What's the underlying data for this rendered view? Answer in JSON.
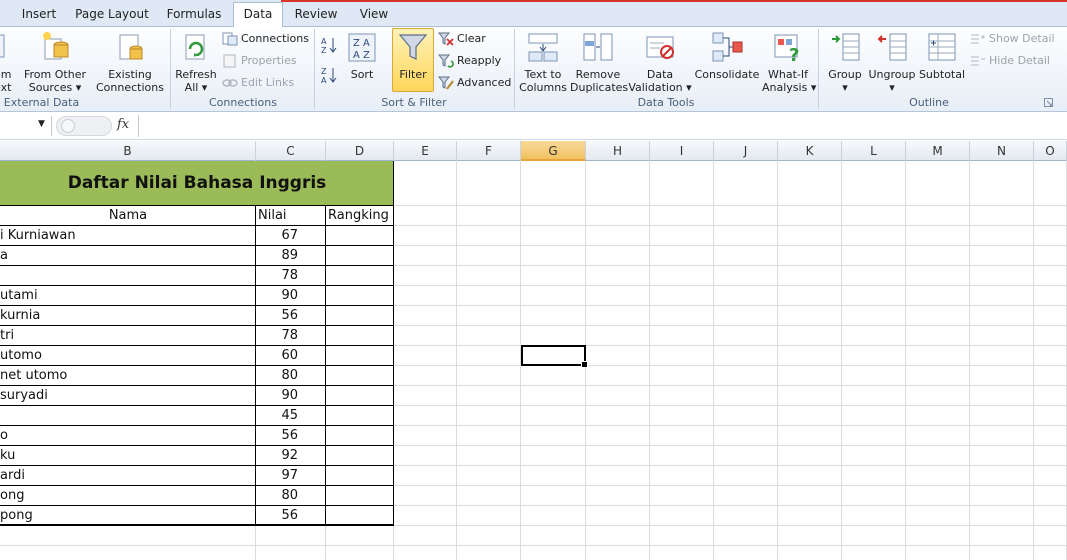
{
  "tabs": [
    "Insert",
    "Page Layout",
    "Formulas",
    "Data",
    "Review",
    "View"
  ],
  "active_tab": "Data",
  "ribbon": {
    "external_data": {
      "label": "t External Data",
      "from_partial": "om\next",
      "from_other": "From Other\nSources ▾",
      "existing": "Existing\nConnections"
    },
    "connections": {
      "label": "Connections",
      "refresh": "Refresh\nAll ▾",
      "connections": "Connections",
      "properties": "Properties",
      "edit_links": "Edit Links"
    },
    "sort_filter": {
      "label": "Sort & Filter",
      "sort": "Sort",
      "filter": "Filter",
      "clear": "Clear",
      "reapply": "Reapply",
      "advanced": "Advanced"
    },
    "data_tools": {
      "label": "Data Tools",
      "text_to_columns": "Text to\nColumns",
      "remove_duplicates": "Remove\nDuplicates",
      "data_validation": "Data\nValidation ▾",
      "consolidate": "Consolidate",
      "what_if": "What-If\nAnalysis ▾"
    },
    "outline": {
      "label": "Outline",
      "group": "Group\n▾",
      "ungroup": "Ungroup\n▾",
      "subtotal": "Subtotal",
      "show_detail": "Show Detail",
      "hide_detail": "Hide Detail"
    }
  },
  "formula_bar": {
    "fx": "fx",
    "value": ""
  },
  "columns": [
    "B",
    "C",
    "D",
    "E",
    "F",
    "G",
    "H",
    "I",
    "J",
    "K",
    "L",
    "M",
    "N",
    "O"
  ],
  "selected_column": "G",
  "sheet": {
    "title": "Daftar Nilai Bahasa Inggris",
    "headers": {
      "name": "Nama",
      "score": "Nilai",
      "rank": "Rangking"
    },
    "rows": [
      {
        "name": "i Kurniawan",
        "score": "67"
      },
      {
        "name": "a",
        "score": "89"
      },
      {
        "name": "",
        "score": "78"
      },
      {
        "name": " utami",
        "score": "90"
      },
      {
        "name": " kurnia",
        "score": "56"
      },
      {
        "name": " tri",
        "score": "78"
      },
      {
        "name": "utomo",
        "score": "60"
      },
      {
        "name": "net utomo",
        "score": "80"
      },
      {
        "name": " suryadi",
        "score": "90"
      },
      {
        "name": "",
        "score": "45"
      },
      {
        "name": "o",
        "score": "56"
      },
      {
        "name": "ku",
        "score": "92"
      },
      {
        "name": "ardi",
        "score": "97"
      },
      {
        "name": "ong",
        "score": "80"
      },
      {
        "name": "pong",
        "score": "56"
      }
    ]
  }
}
